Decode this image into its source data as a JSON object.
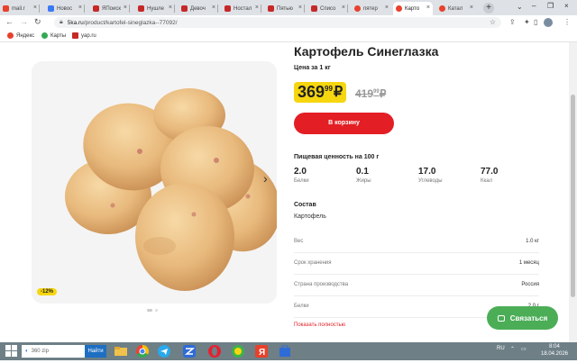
{
  "browser": {
    "tabs": [
      {
        "label": "mail.r",
        "color": "#e8412c"
      },
      {
        "label": "Новос",
        "color": "#3a79f2"
      },
      {
        "label": "ЯПоиск",
        "color": "#c62828"
      },
      {
        "label": "Нушле",
        "color": "#c62828"
      },
      {
        "label": "Девоч",
        "color": "#c62828"
      },
      {
        "label": "Ностал",
        "color": "#c62828"
      },
      {
        "label": "Пятью",
        "color": "#c62828"
      },
      {
        "label": "Списо",
        "color": "#c62828"
      },
      {
        "label": "пятер",
        "color": "#e8412c"
      },
      {
        "label": "Карто",
        "color": "#e8412c",
        "active": true
      },
      {
        "label": "Катал",
        "color": "#e8412c"
      }
    ],
    "url_host": "5ka.ru",
    "url_path": "/product/kartofel-sineglazka--77092/",
    "bookmarks": [
      {
        "label": "Яндекс",
        "color": "#e8412c"
      },
      {
        "label": "Карты",
        "color": "#34a853"
      },
      {
        "label": "yap.ru",
        "color": "#c62828"
      }
    ]
  },
  "product": {
    "title": "Картофель Синеглазка",
    "price_caption": "Цена за 1 кг",
    "price_rub": "369",
    "price_kop": "99",
    "currency": "₽",
    "old_price_rub": "419",
    "old_price_kop": "99",
    "discount": "-12%",
    "cart_button": "В корзину",
    "nutrition_title": "Пищевая ценность на 100 г",
    "nutrition": [
      {
        "value": "2.0",
        "label": "Белки"
      },
      {
        "value": "0.1",
        "label": "Жиры"
      },
      {
        "value": "17.0",
        "label": "Углеводы"
      },
      {
        "value": "77.0",
        "label": "Ккал"
      }
    ],
    "composition_title": "Состав",
    "composition": "Картофель",
    "specs": [
      {
        "label": "Вес",
        "value": "1.0 кг"
      },
      {
        "label": "Срок хранения",
        "value": "1 месяц"
      },
      {
        "label": "Страна производства",
        "value": "Россия"
      },
      {
        "label": "Белки",
        "value": "2.0 г"
      }
    ],
    "show_all": "Показать полностью",
    "contact_button": "Связаться"
  },
  "taskbar": {
    "search_placeholder": "360 zip",
    "search_button": "Найти",
    "lang": "RU",
    "time": "8:04",
    "date": "18.04.2026",
    "apps": [
      {
        "name": "file-explorer",
        "color": "#f0c24b"
      },
      {
        "name": "chrome",
        "color": "#34a853"
      },
      {
        "name": "telegram",
        "color": "#29a9eb"
      },
      {
        "name": "opera",
        "color": "#e5212f"
      },
      {
        "name": "browser-360",
        "color": "#3cb34a"
      },
      {
        "name": "yandex",
        "color": "#e8412c"
      },
      {
        "name": "store",
        "color": "#2e6bd6"
      }
    ]
  }
}
